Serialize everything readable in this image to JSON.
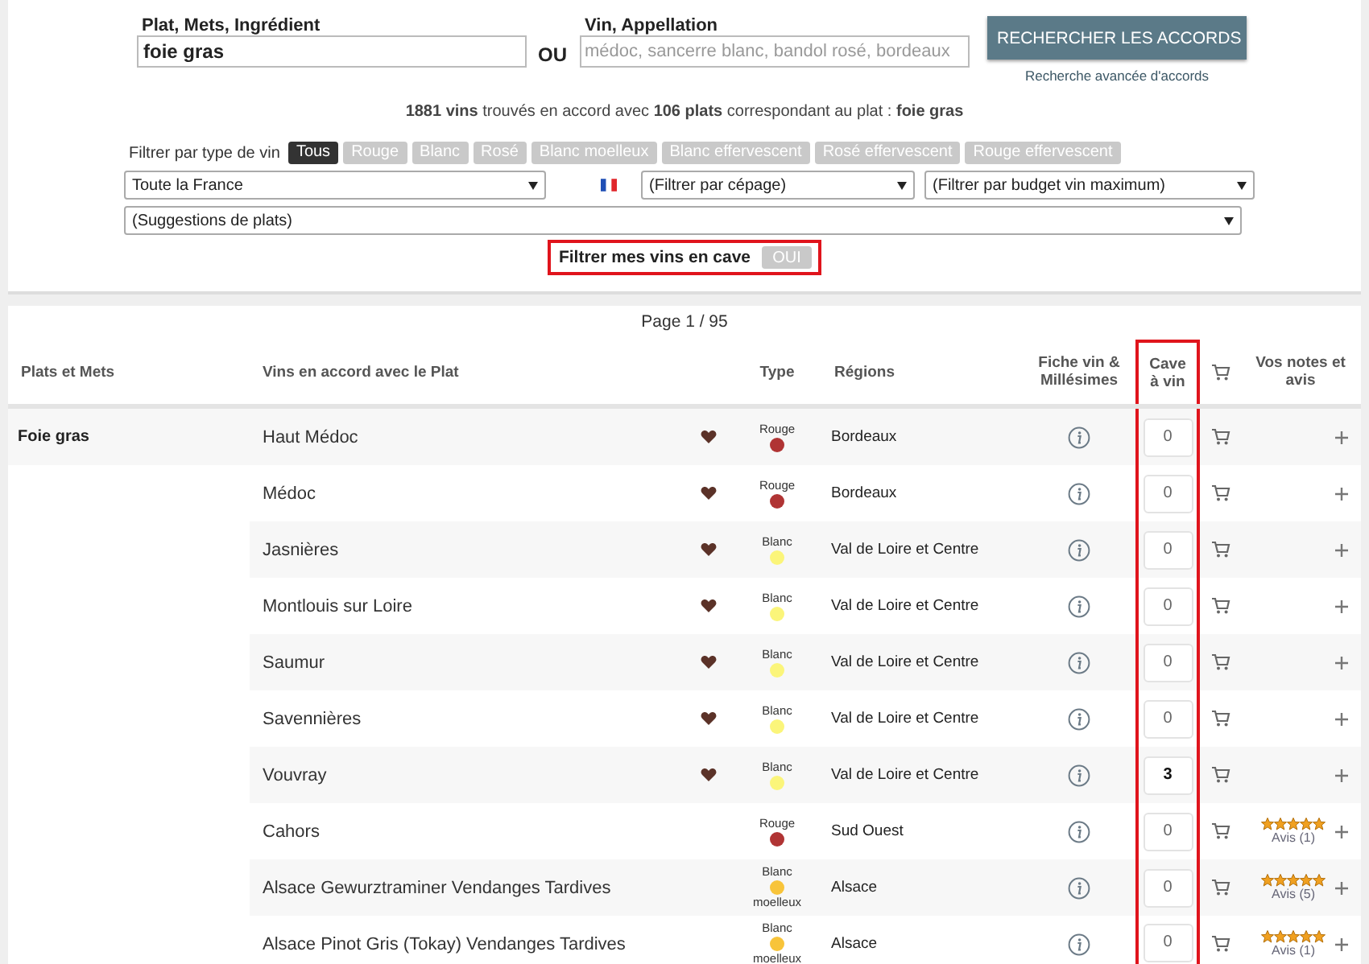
{
  "search": {
    "dish_label": "Plat, Mets, Ingrédient",
    "dish_value": "foie gras",
    "or_label": "OU",
    "wine_label": "Vin, Appellation",
    "wine_placeholder": "médoc, sancerre blanc, bandol rosé, bordeaux",
    "submit": "RECHERCHER LES ACCORDS",
    "advanced_link": "Recherche avancée d'accords"
  },
  "summary": "**1881 vins** trouvés en accord avec **106 plats** correspondant au plat : **foie gras**",
  "type_filter": {
    "label": "Filtrer par type de vin",
    "options": [
      {
        "label": "Tous",
        "selected": true
      },
      {
        "label": "Rouge",
        "selected": false
      },
      {
        "label": "Blanc",
        "selected": false
      },
      {
        "label": "Rosé",
        "selected": false
      },
      {
        "label": "Blanc moelleux",
        "selected": false
      },
      {
        "label": "Blanc effervescent",
        "selected": false
      },
      {
        "label": "Rosé effervescent",
        "selected": false
      },
      {
        "label": "Rouge effervescent",
        "selected": false
      }
    ]
  },
  "selects": {
    "region": "Toute la France",
    "grape": "(Filtrer par cépage)",
    "budget": "(Filtrer par budget vin maximum)",
    "suggestions": "(Suggestions de plats)"
  },
  "cellar_filter": {
    "label": "Filtrer mes vins en cave",
    "toggle": "OUI",
    "on": false,
    "highlighted": true
  },
  "pagination": "Page 1 / 95",
  "table": {
    "cave_highlighted": true,
    "columns": [
      "Plats et Mets",
      "Vins en accord avec le Plat",
      "Type",
      "Régions",
      "Fiche vin & Millésimes",
      "Cave à vin",
      "Vos notes et avis"
    ],
    "rows": [
      {
        "dish": "Foie gras",
        "wine": "Haut Médoc",
        "favorite": true,
        "type": "Rouge",
        "color": "#b03434",
        "region": "Bordeaux",
        "cave": "0"
      },
      {
        "wine": "Médoc",
        "favorite": true,
        "type": "Rouge",
        "color": "#b03434",
        "region": "Bordeaux",
        "cave": "0"
      },
      {
        "wine": "Jasnières",
        "favorite": true,
        "type": "Blanc",
        "color": "#fbf57a",
        "region": "Val de Loire et Centre",
        "cave": "0"
      },
      {
        "wine": "Montlouis sur Loire",
        "favorite": true,
        "type": "Blanc",
        "color": "#fbf57a",
        "region": "Val de Loire et Centre",
        "cave": "0"
      },
      {
        "wine": "Saumur",
        "favorite": true,
        "type": "Blanc",
        "color": "#fbf57a",
        "region": "Val de Loire et Centre",
        "cave": "0"
      },
      {
        "wine": "Savennières",
        "favorite": true,
        "type": "Blanc",
        "color": "#fbf57a",
        "region": "Val de Loire et Centre",
        "cave": "0"
      },
      {
        "wine": "Vouvray",
        "favorite": true,
        "type": "Blanc",
        "color": "#fbf57a",
        "region": "Val de Loire et Centre",
        "cave": "3"
      },
      {
        "wine": "Cahors",
        "favorite": false,
        "type": "Rouge",
        "color": "#b03434",
        "region": "Sud Ouest",
        "cave": "0",
        "stars": 5,
        "reviews": "Avis (1)"
      },
      {
        "wine": "Alsace Gewurztraminer Vendanges Tardives",
        "favorite": false,
        "type": "Blanc",
        "subtype": "moelleux",
        "color": "#f8c43a",
        "region": "Alsace",
        "cave": "0",
        "stars": 5,
        "reviews": "Avis (5)"
      },
      {
        "wine": "Alsace Pinot Gris (Tokay) Vendanges Tardives",
        "favorite": false,
        "type": "Blanc",
        "subtype": "moelleux",
        "color": "#f8c43a",
        "region": "Alsace",
        "cave": "0",
        "stars": 5,
        "reviews": "Avis (1)"
      }
    ]
  }
}
